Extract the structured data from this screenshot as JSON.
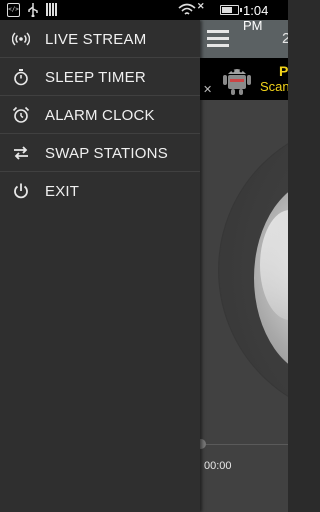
{
  "status_bar": {
    "time": "1:04 PM",
    "battery_level": 0.8,
    "icons": [
      "code-icon",
      "usb-icon",
      "signal-bars-icon",
      "wifi-icon",
      "no-signal-x-icon",
      "battery-icon"
    ]
  },
  "drawer": {
    "items": [
      {
        "label": "LIVE STREAM",
        "icon": "radio-broadcast-icon"
      },
      {
        "label": "SLEEP TIMER",
        "icon": "stopwatch-icon"
      },
      {
        "label": "ALARM CLOCK",
        "icon": "alarm-clock-icon"
      },
      {
        "label": "SWAP STATIONS",
        "icon": "swap-icon"
      },
      {
        "label": "EXIT",
        "icon": "power-icon"
      }
    ]
  },
  "app": {
    "title_partial": "2",
    "ad": {
      "line1": "P",
      "line2": "Scan"
    },
    "elapsed_time": "00:00"
  },
  "colors": {
    "drawer_bg": "#2f2f2f",
    "toolbar_bg": "#5b6163",
    "ad_text": "#f2d31a"
  }
}
